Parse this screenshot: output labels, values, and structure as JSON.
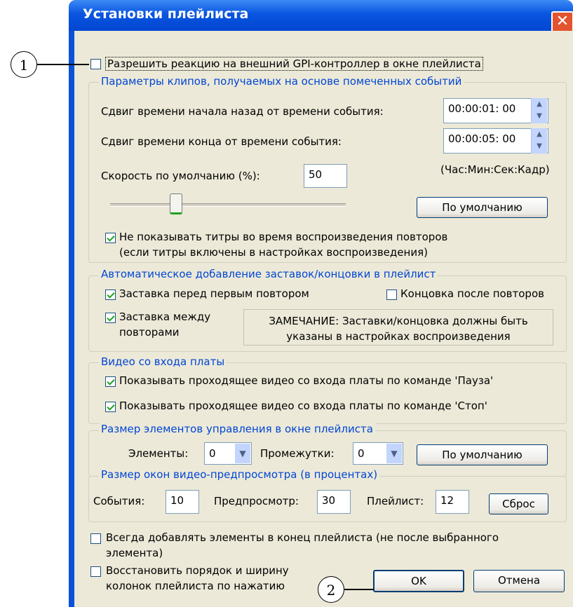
{
  "window": {
    "title": "Установки плейлиста",
    "close_glyph": "✕"
  },
  "gpi": {
    "label": "Разрешить реакцию на внешний GPI-контроллер в окне плейлиста",
    "checked": false
  },
  "clips": {
    "title": "Параметры клипов, получаемых на основе помеченных событий",
    "start_shift_label": "Сдвиг времени начала назад от времени события:",
    "start_shift_value": "00:00:01: 00",
    "end_shift_label": "Сдвиг времени конца от времени события:",
    "end_shift_value": "00:00:05: 00",
    "format_hint": "(Час:Мин:Сек:Кадр)",
    "speed_label": "Скорость по умолчанию (%):",
    "speed_value": "50",
    "speed_slider_fraction": 0.28,
    "default_button": "По умолчанию",
    "hide_titles_line1": "Не показывать титры во время воспроизведения повторов",
    "hide_titles_line2": "(если титры включены в настройках воспроизведения)"
  },
  "auto": {
    "title": "Автоматическое добавление заставок/концовки в плейлист",
    "intro_label": "Заставка перед первым повтором",
    "outro_label": "Концовка после повторов",
    "between_line1": "Заставка между",
    "between_line2": "повторами",
    "note_line1": "ЗАМЕЧАНИЕ: Заставки/концовка должны быть",
    "note_line2": "указаны в настройках воспроизведения"
  },
  "video": {
    "title": "Видео со входа платы",
    "pause_label": "Показывать проходящее видео со входа платы по команде 'Пауза'",
    "stop_label": "Показывать проходящее видео со входа платы по команде 'Стоп'"
  },
  "size": {
    "title": "Размер элементов управления в окне плейлиста",
    "elements_label": "Элементы:",
    "elements_value": "0",
    "gaps_label": "Промежутки:",
    "gaps_value": "0",
    "default_button": "По умолчанию"
  },
  "preview": {
    "title": "Размер окон видео-предпросмотра (в процентах)",
    "events_label": "События:",
    "events_value": "10",
    "preview_label": "Предпросмотр:",
    "preview_value": "30",
    "playlist_label": "Плейлист:",
    "playlist_value": "12",
    "reset_button": "Сброс"
  },
  "bottom": {
    "append_line1": "Всегда добавлять элементы в конец плейлиста (не после выбранного",
    "append_line2": "элемента)",
    "restore_line1": "Восстановить порядок и ширину",
    "restore_line2": "колонок плейлиста по нажатию",
    "ok": "OK",
    "cancel": "Отмена"
  },
  "callouts": {
    "one": "1",
    "two": "2"
  },
  "icons": {
    "checkmark": "check-icon",
    "close": "close-icon",
    "spinner": "spin-arrows-icon",
    "dropdown": "chevron-down-icon"
  },
  "colors": {
    "titlebar": "#0a55e0",
    "group_title": "#0046d5",
    "dialog_bg": "#ece9d8"
  }
}
